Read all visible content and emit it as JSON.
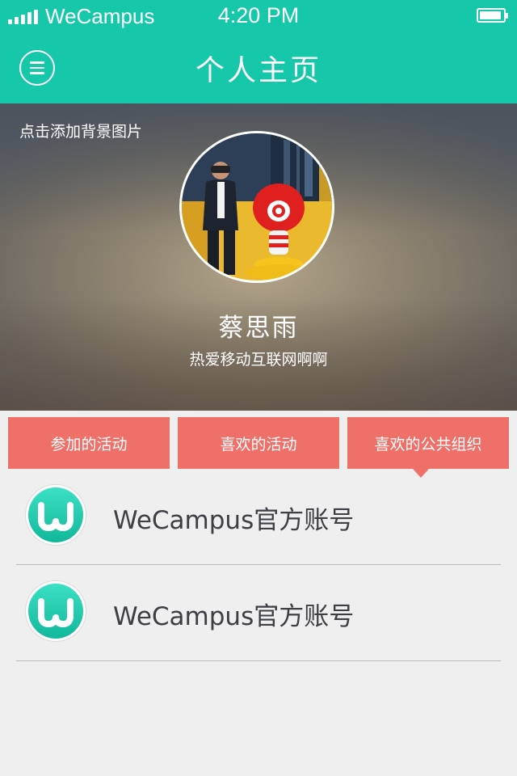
{
  "status_bar": {
    "carrier": "WeCampus",
    "time": "4:20 PM"
  },
  "nav": {
    "title": "个人主页",
    "menu_icon": "menu-icon"
  },
  "hero": {
    "add_background": "点击添加背景图片",
    "name": "蔡思雨",
    "bio": "热爱移动互联网啊啊"
  },
  "tabs": [
    {
      "label": "参加的活动"
    },
    {
      "label": "喜欢的活动"
    },
    {
      "label": "喜欢的公共组织"
    }
  ],
  "active_tab": "喜欢的公共组织",
  "organizations": [
    {
      "name": "WeCampus官方账号",
      "icon": "wecampus-logo-icon"
    },
    {
      "name": "WeCampus官方账号",
      "icon": "wecampus-logo-icon"
    }
  ],
  "colors": {
    "brand": "#16c8a9",
    "tab": "#ee7068",
    "background": "#efefef"
  }
}
